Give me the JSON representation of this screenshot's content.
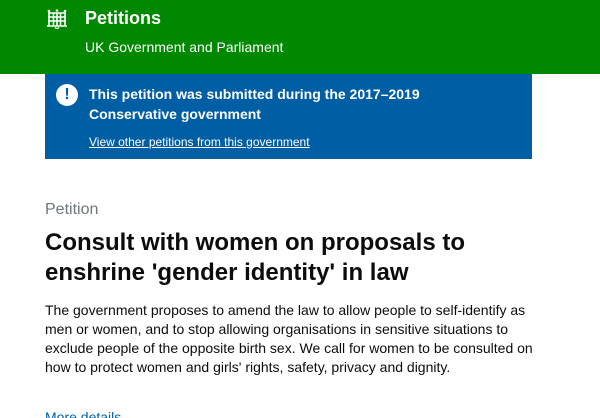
{
  "header": {
    "logo_icon": "portcullis-icon",
    "title": "Petitions",
    "subtitle": "UK Government and Parliament",
    "background_color": "#008800"
  },
  "notice": {
    "icon": "exclamation-icon",
    "text": "This petition was submitted during the 2017–2019 Conservative government",
    "link_label": "View other petitions from this government",
    "background_color": "#005ea5"
  },
  "petition": {
    "caption": "Petition",
    "title": "Consult with women on proposals to enshrine 'gender identity' in law",
    "description": "The government proposes to amend the law to allow people to self-identify as men or women, and to stop allowing organisations in sensitive situations to exclude people of the opposite birth sex. We call for women to be consulted on how to protect women and girls' rights, safety, privacy and dignity.",
    "more_details_label": "More details"
  }
}
